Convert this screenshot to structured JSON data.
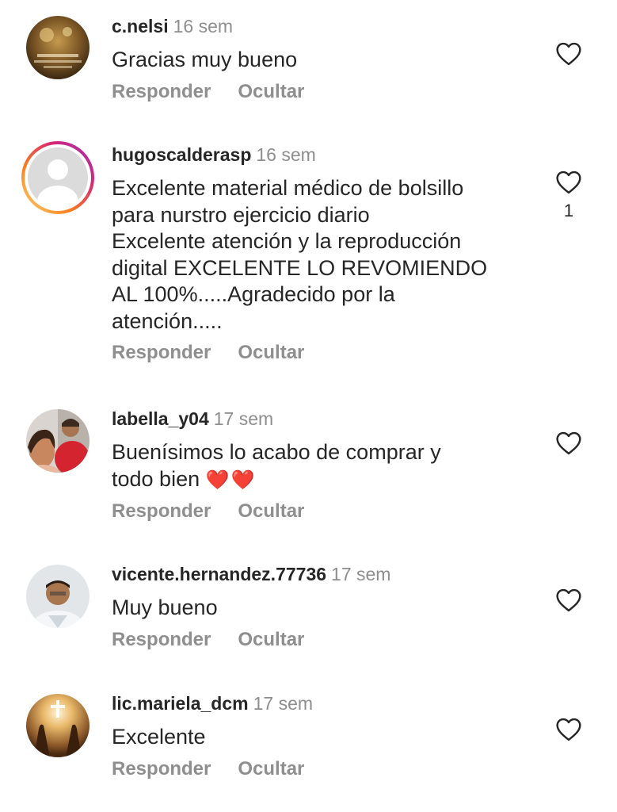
{
  "comments": [
    {
      "username": "c.nelsi",
      "time": "16 sem",
      "text": "Gracias muy bueno",
      "hearts": "",
      "reply_label": "Responder",
      "hide_label": "Ocultar",
      "likes": "",
      "avatar": "photo-flower-logo"
    },
    {
      "username": "hugoscalderasp",
      "time": "16 sem",
      "text": "Excelente material médico de bolsillo\npara nurstro ejercicio diario\nExcelente atención y la reproducción\ndigital EXCELENTE LO REVOMIENDO\nAL 100%.....Agradecido por la\natención.....",
      "hearts": "",
      "reply_label": "Responder",
      "hide_label": "Ocultar",
      "likes": "1",
      "avatar": "default-user-story-ring"
    },
    {
      "username": "labella_y04",
      "time": "17 sem",
      "text": "Buenísimos lo acabo de comprar y\ntodo bien",
      "hearts": "❤️❤️",
      "reply_label": "Responder",
      "hide_label": "Ocultar",
      "likes": "",
      "avatar": "photo-two-people"
    },
    {
      "username": "vicente.hernandez.77736",
      "time": "17 sem",
      "text": "Muy bueno",
      "hearts": "",
      "reply_label": "Responder",
      "hide_label": "Ocultar",
      "likes": "",
      "avatar": "photo-man-white-coat"
    },
    {
      "username": "lic.mariela_dcm",
      "time": "17 sem",
      "text": "Excelente",
      "hearts": "",
      "reply_label": "Responder",
      "hide_label": "Ocultar",
      "likes": "",
      "avatar": "photo-hands-light"
    }
  ],
  "colors": {
    "text": "#262626",
    "secondary": "#8e8e8e",
    "heart": "#ed3b38",
    "story_ring": [
      "#feda75",
      "#fa7e1e",
      "#d62976",
      "#962fbf"
    ]
  }
}
